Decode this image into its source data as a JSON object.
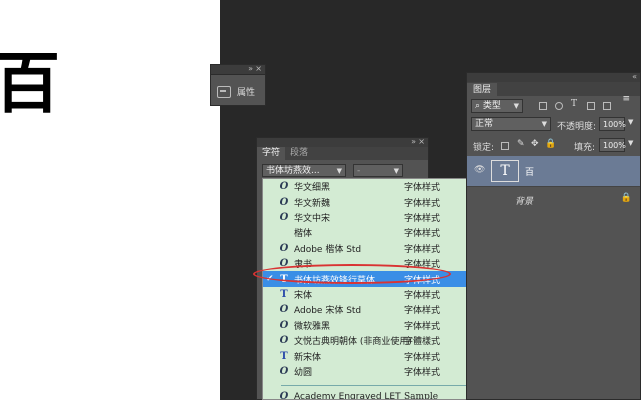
{
  "document": {
    "glyph": "百"
  },
  "properties_panel": {
    "title": "属性"
  },
  "character_panel": {
    "tabs": [
      "字符",
      "段落"
    ],
    "font_value": "书体坊燕效...",
    "style_value": "-"
  },
  "font_list": {
    "items": [
      {
        "icon": "O",
        "name": "华文细黑",
        "sample": "字体样式"
      },
      {
        "icon": "O",
        "name": "华文新魏",
        "sample": "字体样式"
      },
      {
        "icon": "O",
        "name": "华文中宋",
        "sample": "字体样式"
      },
      {
        "icon": "",
        "name": "楷体",
        "sample": "字体样式"
      },
      {
        "icon": "O",
        "name": "Adobe 楷体 Std",
        "sample": "字体样式"
      },
      {
        "icon": "O",
        "name": "隶书",
        "sample": "字体样式"
      },
      {
        "icon": "T",
        "name": "书体坊燕效锋行草体",
        "sample": "字体样式",
        "selected": true
      },
      {
        "icon": "T",
        "name": "宋体",
        "sample": "字体样式"
      },
      {
        "icon": "O",
        "name": "Adobe 宋体 Std",
        "sample": "字体样式"
      },
      {
        "icon": "O",
        "name": "微软雅黑",
        "sample": "字体样式"
      },
      {
        "icon": "O",
        "name": "文悦古典明朝体 (非商业使用)",
        "sample": "字體樣式"
      },
      {
        "icon": "T",
        "name": "新宋体",
        "sample": "字体样式"
      },
      {
        "icon": "O",
        "name": "幼圆",
        "sample": "字体样式"
      }
    ],
    "after_separator": {
      "icon": "O",
      "name": "Academy Engraved LET",
      "sample": "Sample"
    }
  },
  "layers_panel": {
    "tab": "图层",
    "filter": "类型",
    "blend_mode": "正常",
    "opacity_label": "不透明度:",
    "opacity_value": "100%",
    "lock_label": "锁定:",
    "fill_label": "填充:",
    "fill_value": "100%",
    "layers": [
      {
        "name": "百",
        "type": "text"
      },
      {
        "name": "背景",
        "type": "background"
      }
    ]
  },
  "colors": {
    "workspace": "#282828",
    "panel": "#535353",
    "dropdown_bg": "#d3ebd3",
    "selection": "#3a8ee6",
    "annotation": "#d93333"
  }
}
